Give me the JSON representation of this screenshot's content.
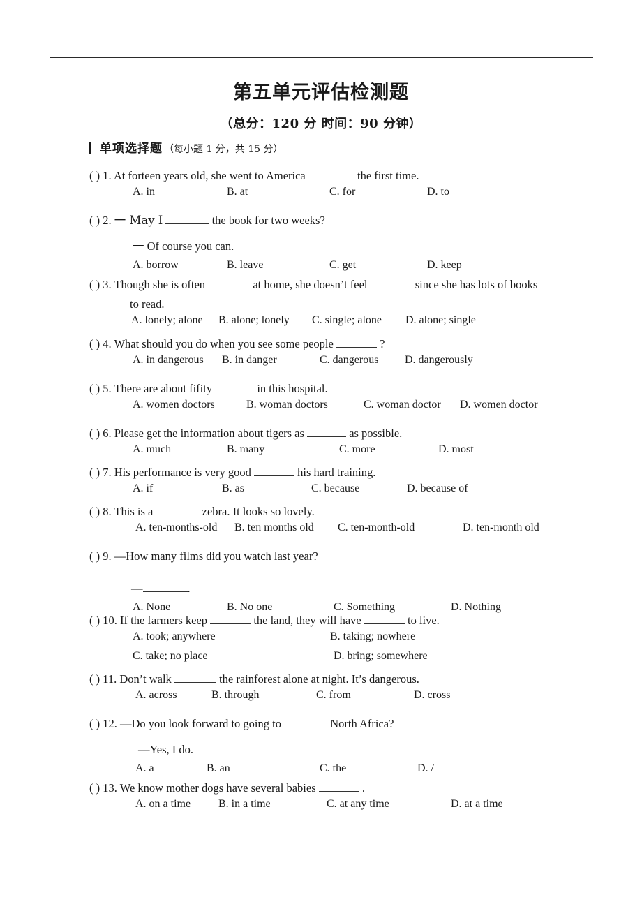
{
  "document": {
    "title": "第五单元评估检测题",
    "subtitle": "（总分：120 分    时间：90 分钟）",
    "section": {
      "marker": "|",
      "title": "单项选择题",
      "note": "（每小题 1 分，共 15 分）"
    }
  },
  "questions": [
    {
      "paren": "(    )",
      "number": "1.",
      "stem_before": "At forteen years old, she went to America",
      "stem_after": "the first time.",
      "options": [
        "A. in",
        "B. at",
        "C. for",
        "D. to"
      ]
    },
    {
      "paren": "(    )",
      "number": "2.",
      "stem_before": "一 May I",
      "stem_after": "the book for two weeks?",
      "continuation": "一  Of course you can.",
      "options": [
        "A. borrow",
        "B. leave",
        "C. get",
        "D. keep"
      ]
    },
    {
      "paren": "(    )",
      "number": "3.",
      "stem_before": "Though she is often",
      "stem_mid": "at home, she doesn’t feel",
      "stem_after": "since she has lots of books",
      "continuation": "to read.",
      "options": [
        "A. lonely; alone",
        "B. alone; lonely",
        "C. single; alone",
        "D. alone; single"
      ]
    },
    {
      "paren": "(    )",
      "number": "4.",
      "stem_before": "What should you do when you see some people",
      "stem_after": "?",
      "options": [
        "A. in dangerous",
        "B. in danger",
        "C. dangerous",
        "D. dangerously"
      ]
    },
    {
      "paren": "(    )",
      "number": "5.",
      "stem_before": "There are about fifity",
      "stem_after": "in this hospital.",
      "options": [
        "A. women doctors",
        "B. woman doctors",
        "C. woman doctor",
        "D. women doctor"
      ]
    },
    {
      "paren": "(    )",
      "number": "6.",
      "stem_before": "Please get the information about tigers as",
      "stem_after": "as possible.",
      "options": [
        "A. much",
        "B. many",
        "C. more",
        "D. most"
      ]
    },
    {
      "paren": "(    )",
      "number": "7.",
      "stem_before": "His performance is very good",
      "stem_after": "his hard training.",
      "options": [
        "A. if",
        "B. as",
        "C. because",
        "D. because of"
      ]
    },
    {
      "paren": "(  )",
      "number": "8.",
      "stem_before": "This is a",
      "stem_after": "zebra. It looks so lovely.",
      "options": [
        "A. ten-months-old",
        "B. ten months old",
        "C. ten-month-old",
        "D. ten-month old"
      ]
    },
    {
      "paren": "(    )",
      "number": "9.",
      "stem_before": "—How many films did you watch last year?",
      "stem_after": "",
      "continuation": "—",
      "continuation_suffix": ".",
      "options": [
        "A. None",
        "B. No one",
        "C. Something",
        "D. Nothing"
      ]
    },
    {
      "paren": "(    )",
      "number": "10.",
      "stem_before": "If the farmers keep",
      "stem_mid": "the land, they will have",
      "stem_after": "to live.",
      "options": [
        "A. took; anywhere",
        "B. taking; nowhere",
        "C. take; no place",
        "D. bring; somewhere"
      ]
    },
    {
      "paren": "(    )",
      "number": "11.",
      "stem_before": "Don’t walk",
      "stem_after": "the rainforest alone at night. It’s dangerous.",
      "options": [
        "A. across",
        "B. through",
        "C. from",
        "D. cross"
      ]
    },
    {
      "paren": "(    )",
      "number": "12.",
      "stem_before": "—Do you look forward to going to",
      "stem_after": "North Africa?",
      "continuation": "—Yes, I do.",
      "options": [
        "A. a",
        "B. an",
        "C. the",
        "D. /"
      ]
    },
    {
      "paren": "(    )",
      "number": "13.",
      "stem_before": "We know mother dogs have several babies",
      "stem_after": ".",
      "options": [
        "A. on a time",
        "B. in a time",
        "C. at any time",
        "D. at a time"
      ]
    }
  ]
}
